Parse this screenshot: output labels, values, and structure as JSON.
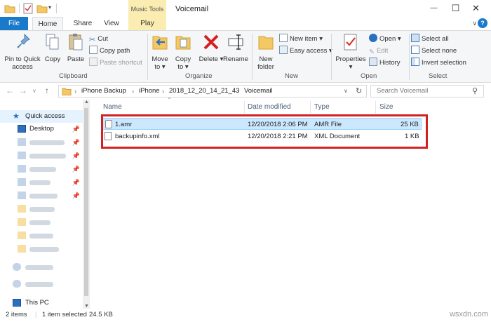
{
  "titlebar": {
    "context_tab_group": "Music Tools",
    "window_title": "Voicemail",
    "minimize": "—",
    "maximize": "☐",
    "close": "✕"
  },
  "tabs": {
    "file": "File",
    "home": "Home",
    "share": "Share",
    "view": "View",
    "play": "Play",
    "help": "?"
  },
  "ribbon": {
    "clipboard": {
      "label": "Clipboard",
      "pin": "Pin to Quick access",
      "pin_line1": "Pin to Quick",
      "pin_line2": "access",
      "copy": "Copy",
      "paste": "Paste",
      "cut": "Cut",
      "copy_path": "Copy path",
      "paste_shortcut": "Paste shortcut"
    },
    "organize": {
      "label": "Organize",
      "move_to": "Move to",
      "move_line1": "Move",
      "move_line2": "to ▾",
      "copy_to": "Copy to",
      "copy_line1": "Copy",
      "copy_line2": "to ▾",
      "delete": "Delete ▾",
      "rename": "Rename"
    },
    "new": {
      "label": "New",
      "new_folder_line1": "New",
      "new_folder_line2": "folder",
      "new_item": "New item ▾",
      "easy_access": "Easy access ▾"
    },
    "open": {
      "label": "Open",
      "properties_line1": "Properties",
      "properties_line2": "▾",
      "open": "Open ▾",
      "edit": "Edit",
      "history": "History"
    },
    "select": {
      "label": "Select",
      "select_all": "Select all",
      "select_none": "Select none",
      "invert": "Invert selection"
    }
  },
  "address": {
    "crumbs": [
      "iPhone Backup",
      "iPhone",
      "2018_12_20_14_21_43",
      "Voicemail"
    ],
    "search_placeholder": "Search Voicemail"
  },
  "navpane": {
    "quick_access": "Quick access",
    "desktop": "Desktop",
    "this_pc": "This PC"
  },
  "filelist": {
    "columns": [
      "Name",
      "Date modified",
      "Type",
      "Size"
    ],
    "rows": [
      {
        "name": "1.amr",
        "date": "12/20/2018 2:06 PM",
        "type": "AMR File",
        "size": "25 KB"
      },
      {
        "name": "backupinfo.xml",
        "date": "12/20/2018 2:21 PM",
        "type": "XML Document",
        "size": "1 KB"
      }
    ]
  },
  "status": {
    "items": "2 items",
    "selected": "1 item selected",
    "size": "24.5 KB",
    "watermark": "wsxdn.com"
  },
  "colors": {
    "accent": "#1979ca",
    "selection": "#cce8ff",
    "highlight_box": "#d32020",
    "music_tools": "#fbecb1"
  }
}
